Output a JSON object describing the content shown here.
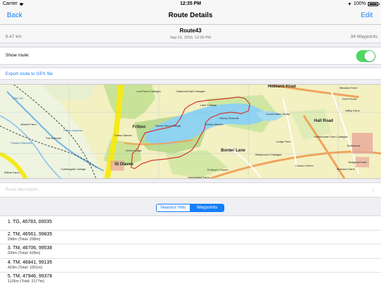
{
  "status_bar": {
    "carrier": "Carrier",
    "time": "12:35 PM",
    "battery": "100%"
  },
  "nav": {
    "back_label": "Back",
    "title": "Route Details",
    "edit_label": "Edit"
  },
  "route": {
    "name": "Route43",
    "date": "Sep 22, 2016, 12:30 PM",
    "distance": "9.47 km",
    "waypoints": "34 Waypoints"
  },
  "show_route": {
    "label": "Show route:",
    "on": true
  },
  "export": {
    "label": "Export route to GPX file"
  },
  "map": {
    "labels": [
      "Hobland Road",
      "Low Farm Cottages",
      "Caldecott Hall Cottages",
      "Meadow Farm",
      "Kent House",
      "Valley Farm",
      "Fritton Marshes",
      "Thurlton Marshes",
      "Fritton",
      "Fritton Warren",
      "St Olaves",
      "Decoy Farm Cottage",
      "Lake Cottage",
      "Decoy Grounds",
      "Kerley Warren",
      "Lound Water Works",
      "Border Lane",
      "Lodge Farm",
      "Whitehouse Farm Cottages",
      "Bridsmore's Cottages",
      "Cuckoo Green",
      "St Mary's Church",
      "Market Farm",
      "The Burrows",
      "Willow Farm",
      "Colliersgate Cottage",
      "Bollentone",
      "Homestead Farm",
      "Beeches Farm",
      "Hall Road",
      "Green Lodge",
      "Bridgend Farm",
      "Clay Cut"
    ],
    "colors": {
      "route": "#d8342a",
      "water": "#8fd3f0",
      "woods": "#b6d88c",
      "major_road": "#f5e91b"
    }
  },
  "description": {
    "placeholder": "Route description...",
    "icon": "chevron-right-icon"
  },
  "segments": {
    "items": [
      "Nearest Hills",
      "Waypoints"
    ],
    "selected": "Waypoints"
  },
  "waypoints": [
    {
      "title": "1. TG, 46783, 00035",
      "subtitle": ""
    },
    {
      "title": "2. TM, 46561, 99835",
      "subtitle": "298m (Total: 298m)"
    },
    {
      "title": "3. TM, 46706, 99538",
      "subtitle": "330m (Total: 628m)"
    },
    {
      "title": "4. TM, 46841, 99135",
      "subtitle": "423m (Total: 1051m)"
    },
    {
      "title": "5. TM, 47946, 99378",
      "subtitle": "1126m (Total: 2177m)"
    }
  ]
}
